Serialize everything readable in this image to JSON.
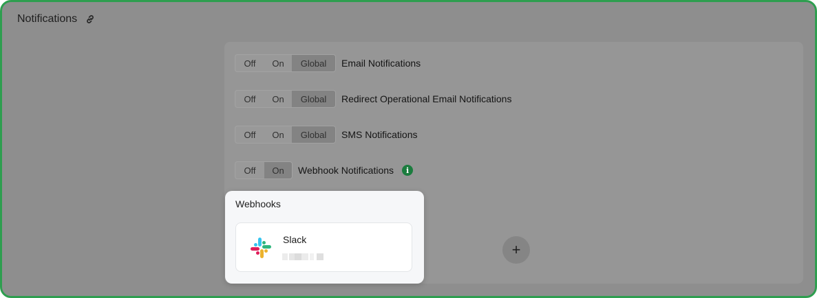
{
  "header": {
    "title": "Notifications",
    "link_icon": "link-icon"
  },
  "segment_labels": {
    "off": "Off",
    "on": "On",
    "global": "Global"
  },
  "settings": [
    {
      "label": "Email Notifications",
      "options": [
        "Off",
        "On",
        "Global"
      ],
      "selected": "Global"
    },
    {
      "label": "Redirect Operational Email Notifications",
      "options": [
        "Off",
        "On",
        "Global"
      ],
      "selected": "Global"
    },
    {
      "label": "SMS Notifications",
      "options": [
        "Off",
        "On",
        "Global"
      ],
      "selected": "Global"
    },
    {
      "label": "Webhook Notifications",
      "options": [
        "Off",
        "On"
      ],
      "selected": "On",
      "info_icon": "info-icon"
    }
  ],
  "add_button": {
    "label": "+",
    "icon": "plus-icon"
  },
  "webhooks": {
    "title": "Webhooks",
    "items": [
      {
        "name": "Slack",
        "icon": "slack-logo",
        "detail_redacted": true
      }
    ]
  },
  "colors": {
    "frame_border": "#2e9e4f",
    "info_icon": "#1b7c3e",
    "slack_blue": "#36c5f0",
    "slack_green": "#2eb67d",
    "slack_yellow": "#ecb22e",
    "slack_red": "#e01e5a"
  }
}
